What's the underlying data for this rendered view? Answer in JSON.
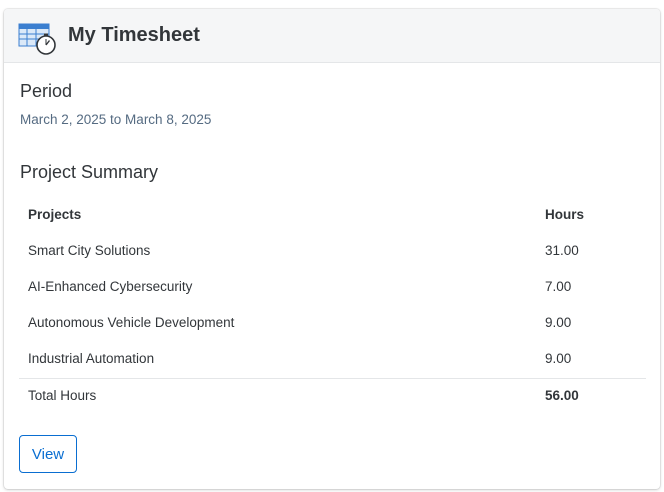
{
  "card": {
    "title": "My Timesheet",
    "icon": "timesheet-stopwatch-icon"
  },
  "period": {
    "heading": "Period",
    "range": "March 2, 2025 to March 8, 2025"
  },
  "summary": {
    "heading": "Project Summary",
    "columns": [
      "Projects",
      "Hours"
    ],
    "rows": [
      {
        "project": "Smart City Solutions",
        "hours": "31.00"
      },
      {
        "project": "AI-Enhanced Cybersecurity",
        "hours": "7.00"
      },
      {
        "project": "Autonomous Vehicle Development",
        "hours": "9.00"
      },
      {
        "project": "Industrial Automation",
        "hours": "9.00"
      }
    ],
    "total": {
      "label": "Total Hours",
      "hours": "56.00"
    }
  },
  "actions": {
    "view_label": "View"
  },
  "colors": {
    "accent": "#0a6ed1",
    "header_bg": "#f5f6f7",
    "text": "#32363a",
    "muted_text": "#556b82"
  }
}
